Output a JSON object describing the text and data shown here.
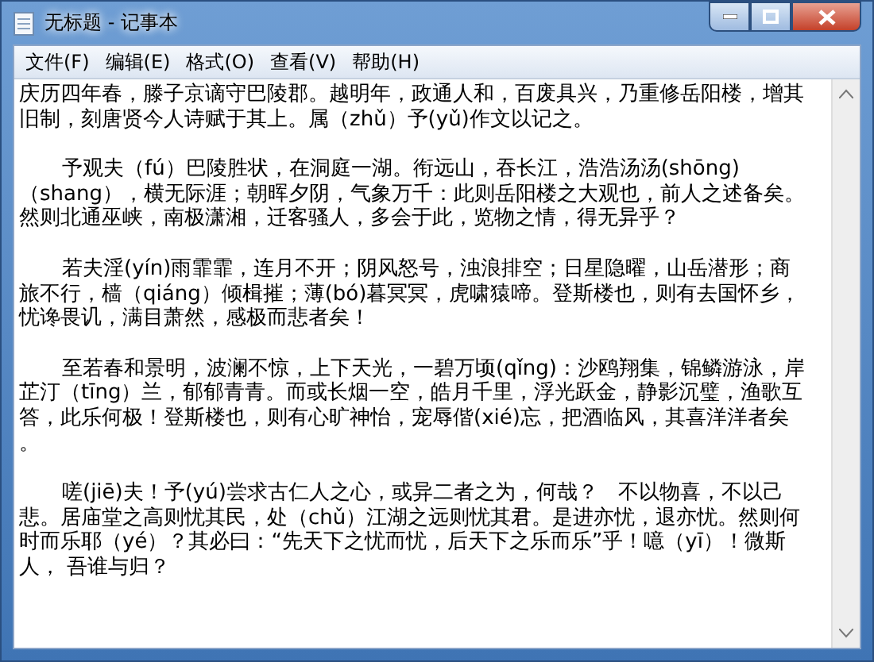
{
  "window": {
    "title": "无标题 - 记事本"
  },
  "menu": [
    "文件(F)",
    "编辑(E)",
    "格式(O)",
    "查看(V)",
    "帮助(H)"
  ],
  "paragraphs": [
    {
      "indented": false,
      "lines": [
        "庆历四年春，滕子京谪守巴陵郡。越明年，政通人和，百废具兴，乃重修岳阳楼，增其",
        "旧制，刻唐贤今人诗赋于其上。属（zhǔ）予(yǔ)作文以记之。"
      ]
    },
    {
      "indented": true,
      "lines": [
        "予观夫（fú）巴陵胜状，在洞庭一湖。衔远山，吞长江，浩浩汤汤(shōng)",
        "（shang），横无际涯；朝晖夕阴，气象万千：此则岳阳楼之大观也，前人之述备矣。",
        "然则北通巫峡，南极潇湘，迁客骚人，多会于此，览物之情，得无异乎？"
      ]
    },
    {
      "indented": true,
      "lines": [
        "若夫淫(yín)雨霏霏，连月不开；阴风怒号，浊浪排空；日星隐曜，山岳潜形；商",
        "旅不行，樯（qiáng）倾楫摧；薄(bó)暮冥冥，虎啸猿啼。登斯楼也，则有去国怀乡，",
        "忧谗畏讥，满目萧然，感极而悲者矣！"
      ]
    },
    {
      "indented": true,
      "lines": [
        "至若春和景明，波澜不惊，上下天光，一碧万顷(qǐng)：沙鸥翔集，锦鳞游泳，岸",
        "芷汀（tīng）兰，郁郁青青。而或长烟一空，皓月千里，浮光跃金，静影沉璧，渔歌互",
        "答，此乐何极！登斯楼也，则有心旷神怡，宠辱偕(xié)忘，把酒临风，其喜洋洋者矣",
        "。"
      ]
    },
    {
      "indented": true,
      "lines": [
        "嗟(jiē)夫！予(yú)尝求古仁人之心，或异二者之为，何哉？   不以物喜，不以己",
        "悲。居庙堂之高则忧其民，处（chǔ）江湖之远则忧其君。是进亦忧，退亦忧。然则何",
        "时而乐耶（yé）？其必曰：“先天下之忧而忧，后天下之乐而乐”乎！噫（yī）！微斯",
        "人， 吾谁与归？"
      ]
    }
  ]
}
